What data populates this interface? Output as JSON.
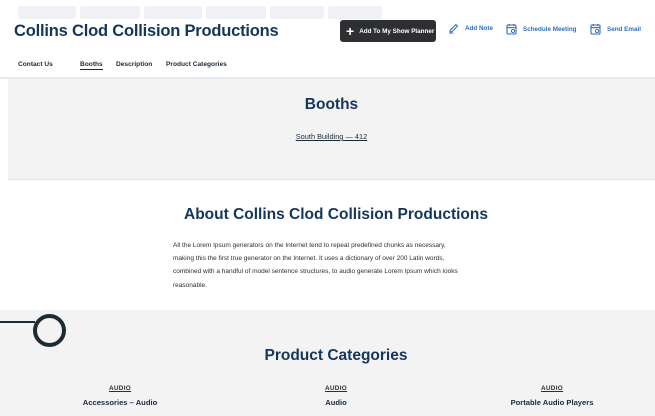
{
  "company": {
    "title": "Collins Clod Collision Productions"
  },
  "actions": {
    "planner": "Add To My Show Planner",
    "note": "Add Note",
    "meeting": "Schedule Meeting",
    "email": "Send Email"
  },
  "tabs": [
    "Contact Us",
    "Booths",
    "Description",
    "Product Categories"
  ],
  "active_tab": "Booths",
  "booths": {
    "title": "Booths",
    "location": "South Building — 412"
  },
  "about": {
    "title": "About Collins Clod Collision Productions",
    "lines": [
      "All the Lorem Ipsum generators on the Internet tend to repeat predefined chunks as necessary,",
      "making this the first true generator on the Internet. It uses a dictionary of over 200 Latin words,",
      "combined with a handful of model sentence structures, to audio generate Lorem Ipsum which looks",
      "reasonable."
    ]
  },
  "categories": {
    "title": "Product Categories",
    "items": [
      {
        "group": "AUDIO",
        "name": "Accessories – Audio"
      },
      {
        "group": "AUDIO",
        "name": "Audio"
      },
      {
        "group": "AUDIO",
        "name": "Portable Audio Players"
      }
    ]
  },
  "colors": {
    "brand": "#14365a",
    "link_blue": "#2f6dbf",
    "planner_button": "#2d2f33",
    "panel_bg": "#f3f3f4"
  },
  "icons": {
    "planner": "plus-icon",
    "note": "pen-icon",
    "meeting": "calendar-icon",
    "email": "calendar-email-icon"
  }
}
